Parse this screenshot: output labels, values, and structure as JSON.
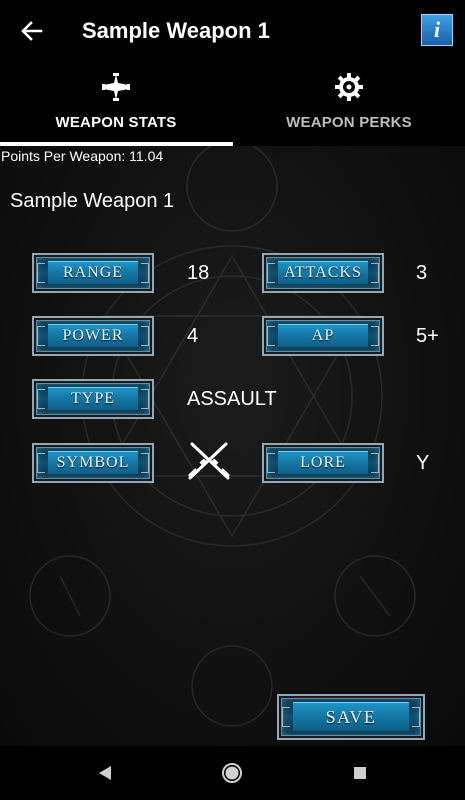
{
  "appbar": {
    "title": "Sample Weapon 1",
    "back_icon": "arrow-left-icon",
    "info_icon": "info-icon",
    "info_glyph": "i"
  },
  "tabs": [
    {
      "label": "WEAPON STATS",
      "icon": "cross-icon",
      "active": true
    },
    {
      "label": "WEAPON PERKS",
      "icon": "gear-icon",
      "active": false
    }
  ],
  "points_per_weapon": "Points Per Weapon: 11.04",
  "weapon_name": "Sample Weapon 1",
  "stats": {
    "range": {
      "label": "RANGE",
      "value": "18"
    },
    "attacks": {
      "label": "ATTACKS",
      "value": "3"
    },
    "power": {
      "label": "POWER",
      "value": "4"
    },
    "ap": {
      "label": "AP",
      "value": "5+"
    },
    "type": {
      "label": "TYPE",
      "value": "ASSAULT"
    },
    "symbol": {
      "label": "SYMBOL",
      "icon": "crossed-rifles-icon"
    },
    "lore": {
      "label": "LORE",
      "value": "Y"
    }
  },
  "save_label": "SAVE",
  "navbar": {
    "back": "nav-back-icon",
    "home": "nav-home-icon",
    "recents": "nav-recents-icon"
  },
  "colors": {
    "background": "#0b0b0b",
    "bar": "#000000",
    "button_blue": "#1479a8",
    "button_border": "#8fa9b8",
    "info_blue": "#3ea0e6"
  }
}
